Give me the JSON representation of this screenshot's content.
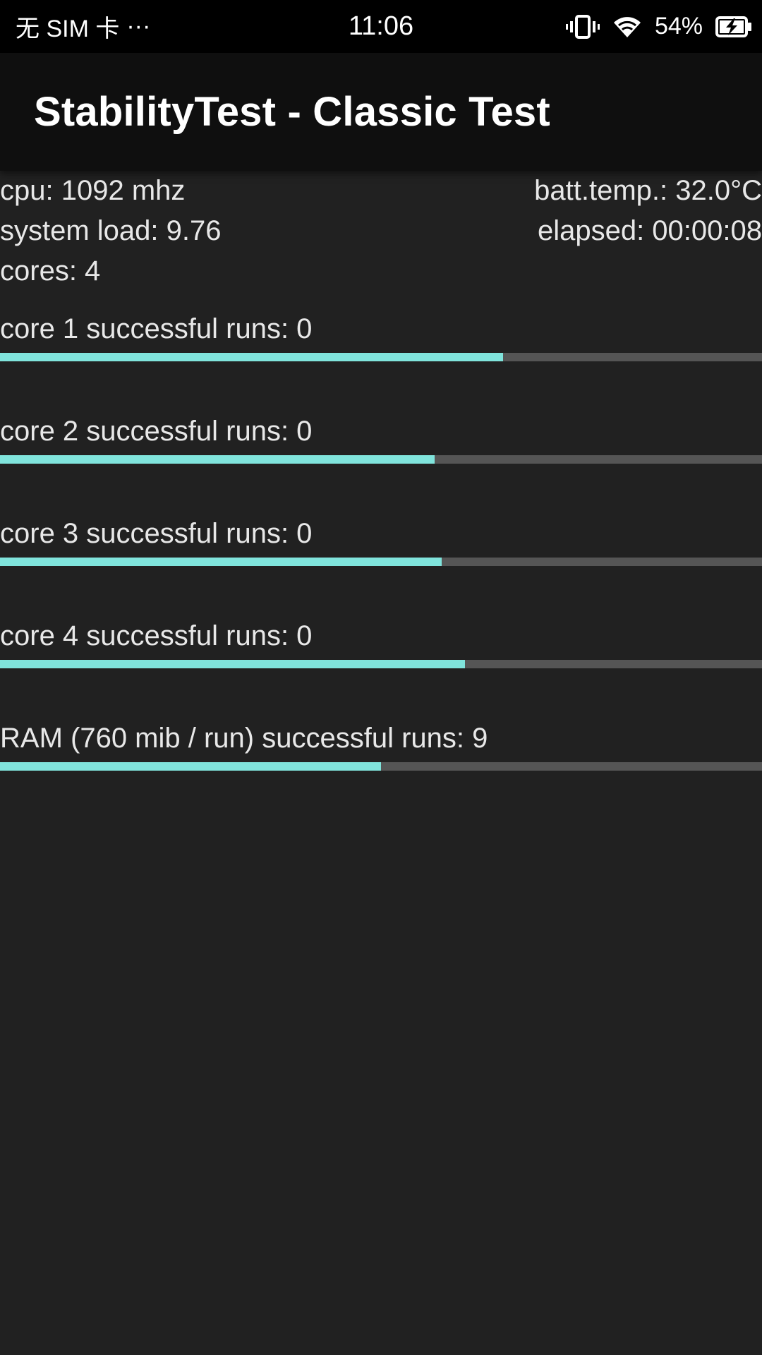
{
  "status_bar": {
    "carrier": "无 SIM 卡",
    "more": "···",
    "time": "11:06",
    "battery_percent": "54%",
    "icons": [
      "vibrate-icon",
      "wifi-icon",
      "battery-charging-icon"
    ]
  },
  "app_bar": {
    "title": "StabilityTest - Classic Test"
  },
  "info": {
    "cpu": "cpu: 1092 mhz",
    "batt_temp": "batt.temp.: 32.0°C",
    "system_load": "system load: 9.76",
    "elapsed": "elapsed: 00:00:08",
    "cores": "cores: 4"
  },
  "tests": [
    {
      "label": "core 1 successful runs: 0",
      "progress": 0.66
    },
    {
      "label": "core 2 successful runs: 0",
      "progress": 0.57
    },
    {
      "label": "core 3 successful runs: 0",
      "progress": 0.58
    },
    {
      "label": "core 4 successful runs: 0",
      "progress": 0.61
    },
    {
      "label": "RAM (760 mib / run) successful runs: 9",
      "progress": 0.5
    }
  ],
  "colors": {
    "accent": "#80e4dc",
    "track": "#555555",
    "background": "#212121",
    "app_bar": "#0f0f0f",
    "status_bar": "#000000"
  }
}
